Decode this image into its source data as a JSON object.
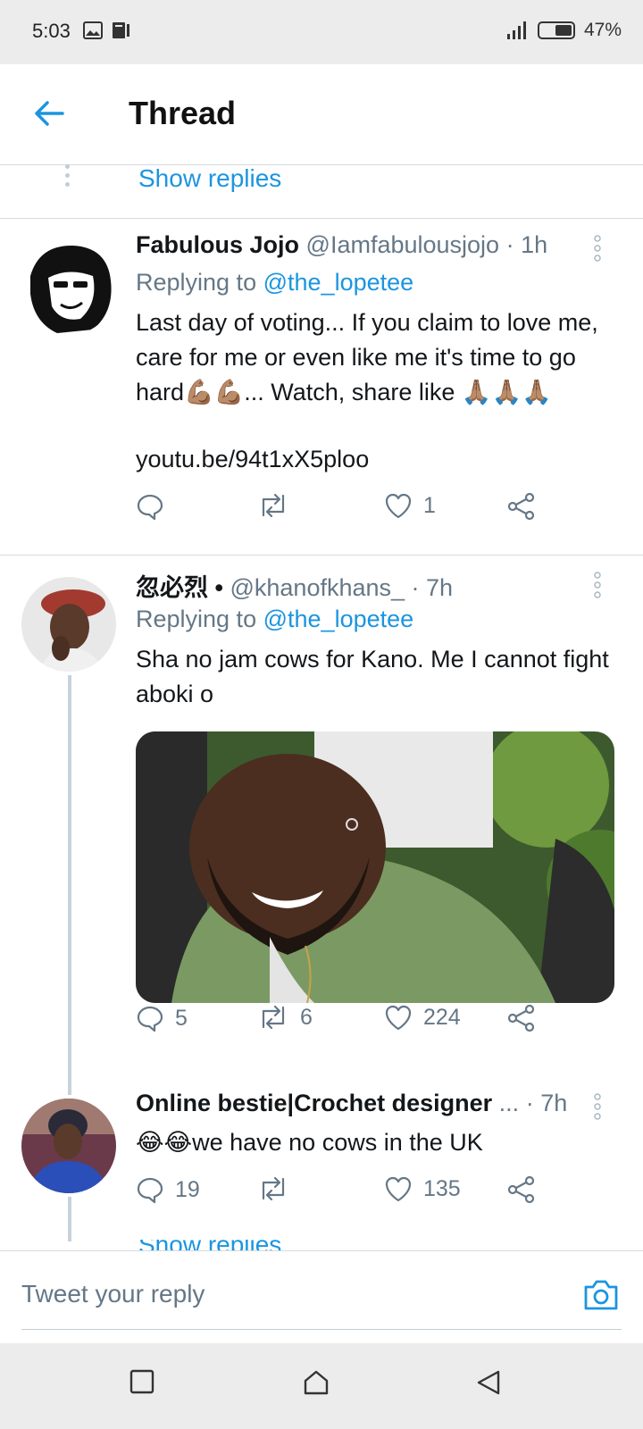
{
  "status_bar": {
    "time": "5:03",
    "battery": "47%"
  },
  "header": {
    "title": "Thread"
  },
  "show_replies_label": "Show replies",
  "tweets": [
    {
      "name": "Fabulous Jojo",
      "handle": "@Iamfabulousjojo",
      "time": "· 1h",
      "replying_prefix": "Replying to",
      "replying_to": "@the_lopetee",
      "text": "Last day of voting... If you claim to love me, care for me or even like me it's time to go hard💪🏽💪🏽... Watch, share like 🙏🏽🙏🏽🙏🏽",
      "link": "youtu.be/94t1xX5ploo",
      "replies": "",
      "retweets": "",
      "likes": "1"
    },
    {
      "name": "忽必烈 •",
      "handle": "@khanofkhans_",
      "time": "· 7h",
      "replying_prefix": "Replying to",
      "replying_to": "@the_lopetee",
      "text": "Sha no jam cows for Kano. Me I cannot fight aboki o",
      "replies": "5",
      "retweets": "6",
      "likes": "224"
    },
    {
      "name": "Online bestie|Crochet designer",
      "handle": "...",
      "time": "· 7h",
      "text": "😂😂we have no cows in the UK",
      "replies": "19",
      "retweets": "",
      "likes": "135"
    }
  ],
  "reply_bar": {
    "placeholder": "Tweet your reply"
  },
  "colors": {
    "accent": "#1b95e0",
    "muted": "#657786",
    "divider": "#d6dbe0"
  }
}
